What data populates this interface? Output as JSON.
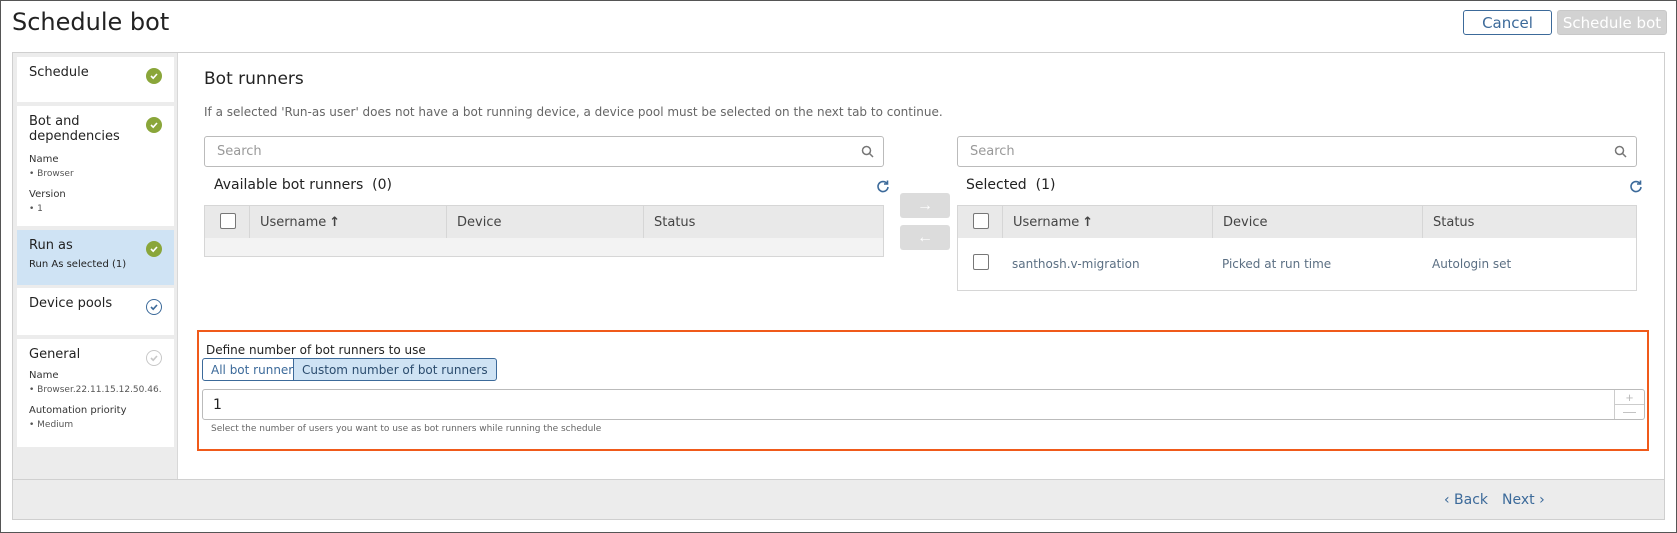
{
  "header": {
    "title": "Schedule bot",
    "cancel_label": "Cancel",
    "schedule_label": "Schedule bot"
  },
  "sidebar": {
    "schedule": {
      "title": "Schedule"
    },
    "bot": {
      "title": "Bot and dependencies",
      "name_label": "Name",
      "name_value": "• Browser",
      "version_label": "Version",
      "version_value": "• 1"
    },
    "run_as": {
      "title": "Run as",
      "sub": "Run As selected (1)"
    },
    "device_pools": {
      "title": "Device pools"
    },
    "general": {
      "title": "General",
      "name_label": "Name",
      "name_value": "• Browser.22.11.15.12.50.46...",
      "priority_label": "Automation priority",
      "priority_value": "• Medium"
    }
  },
  "main": {
    "title": "Bot runners",
    "hint": "If a selected 'Run-as user' does not have a bot running device, a device pool must be selected on the next tab to continue.",
    "available": {
      "search_placeholder": "Search",
      "title": "Available bot runners",
      "count": "(0)",
      "columns": [
        "Username",
        "Device",
        "Status"
      ],
      "sort_icon": "↑"
    },
    "selected": {
      "search_placeholder": "Search",
      "title": "Selected",
      "count": "(1)",
      "columns": [
        "Username",
        "Device",
        "Status"
      ],
      "sort_icon": "↑",
      "rows": [
        {
          "username": "santhosh.v-migration",
          "device": "Picked at run time",
          "status": "Autologin set"
        }
      ]
    },
    "move_right": "→",
    "move_left": "←"
  },
  "define": {
    "label": "Define number of bot runners to use",
    "options": [
      "All bot runners",
      "Custom number of bot runners"
    ],
    "selected_option": "Custom number of bot runners",
    "value": "1",
    "spin_up": "+",
    "spin_down": "—",
    "help": "Select the number of users you want to use as bot runners while running the schedule"
  },
  "footer": {
    "back_label": "‹ Back",
    "next_label": "Next ›"
  },
  "colors": {
    "accent": "#3c6a9a",
    "done": "#8aa63a",
    "highlight": "#f05a1a",
    "active_step": "#cfe3f4"
  }
}
